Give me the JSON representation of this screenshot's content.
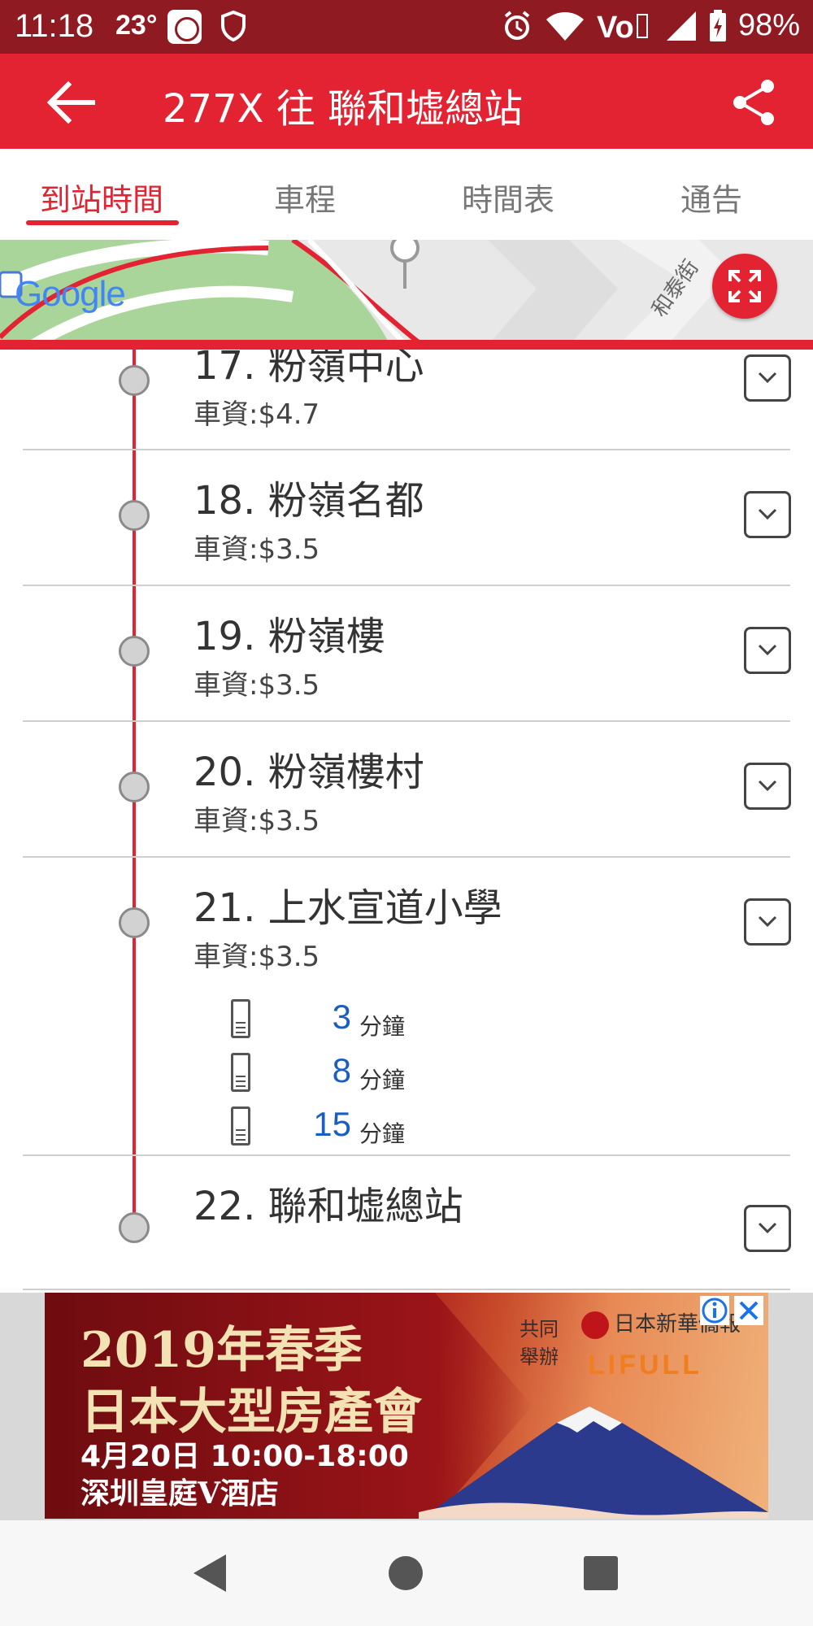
{
  "status_bar": {
    "time": "11:18",
    "temperature": "23°",
    "battery": "98%",
    "icons": [
      "mi-icon",
      "shield-icon",
      "alarm-icon",
      "wifi-icon",
      "volte-icon",
      "signal-icon",
      "battery-charging-icon"
    ]
  },
  "app_bar": {
    "title": "277X 往 聯和墟總站",
    "back_icon": "back-arrow-icon",
    "share_icon": "share-icon",
    "color": "#e32232"
  },
  "tabs": [
    {
      "label": "到站時間",
      "active": true
    },
    {
      "label": "車程",
      "active": false
    },
    {
      "label": "時間表",
      "active": false
    },
    {
      "label": "通告",
      "active": false
    }
  ],
  "map": {
    "logo": "Google",
    "street_label": "和泰街",
    "expand_icon": "fullscreen-icon"
  },
  "stops": [
    {
      "name": "17. 粉嶺中心",
      "fare": "車資:$4.7"
    },
    {
      "name": "18. 粉嶺名都",
      "fare": "車資:$3.5"
    },
    {
      "name": "19. 粉嶺樓",
      "fare": "車資:$3.5"
    },
    {
      "name": "20. 粉嶺樓村",
      "fare": "車資:$3.5"
    },
    {
      "name": "21. 上水宣道小學",
      "fare": "車資:$3.5"
    },
    {
      "name": "22. 聯和墟總站",
      "fare": ""
    }
  ],
  "etas": [
    {
      "minutes": "3",
      "unit": "分鐘"
    },
    {
      "minutes": "8",
      "unit": "分鐘"
    },
    {
      "minutes": "15",
      "unit": "分鐘"
    }
  ],
  "ad": {
    "line1": "2019年春季",
    "line2": "日本大型房產會",
    "line3": "4月20日 10:00-18:00",
    "line4": "深圳皇庭V酒店",
    "cohost": "共同舉辦",
    "logo1_text": "日本新華僑報",
    "logo2_text": "LIFULL",
    "info_icon": "ad-info-icon",
    "close_icon": "ad-close-icon"
  },
  "colors": {
    "accent": "#e32232",
    "status_bar": "#8f1a22",
    "eta_number": "#1a5fbf"
  }
}
